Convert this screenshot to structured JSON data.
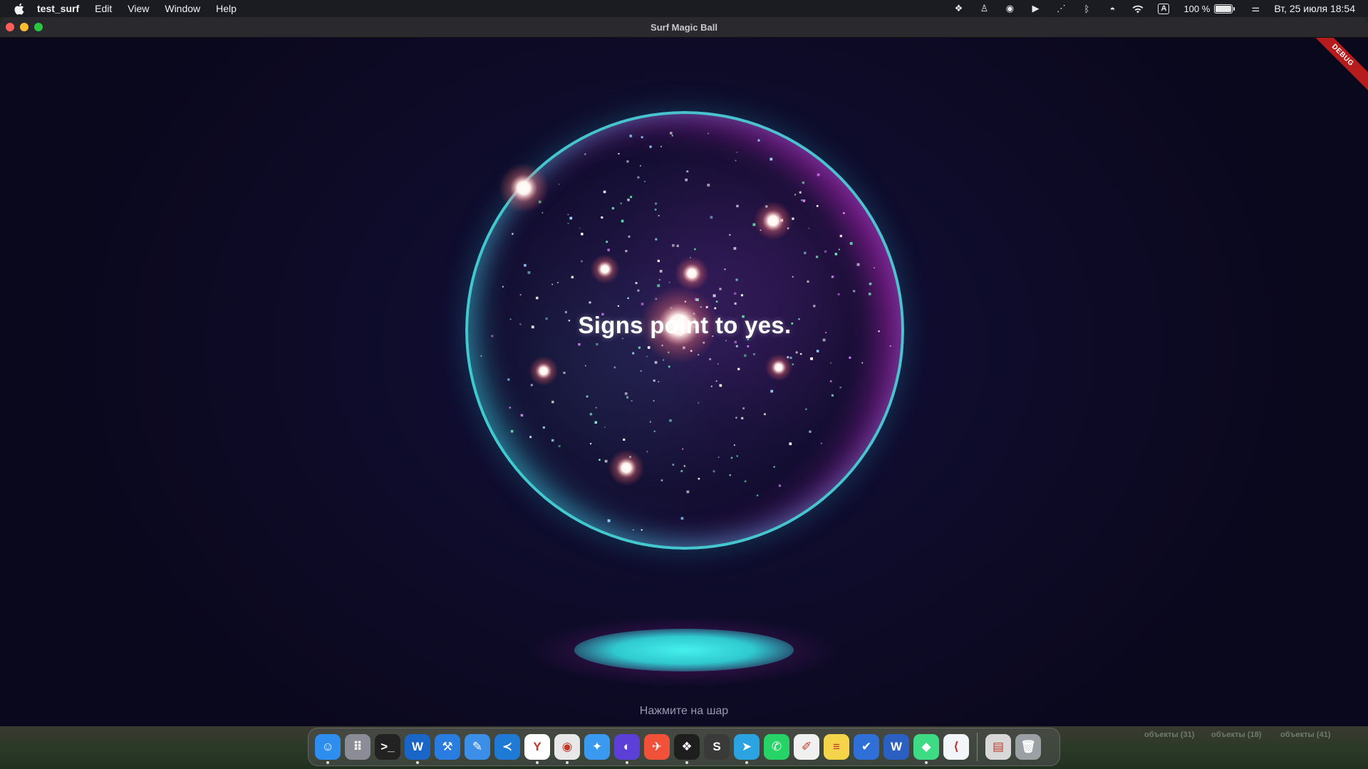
{
  "menubar": {
    "app_name": "test_surf",
    "items": [
      "Edit",
      "View",
      "Window",
      "Help"
    ],
    "status_icons": [
      "figma-icon",
      "android-icon",
      "compass-icon",
      "play-icon",
      "activity-icon",
      "bluetooth-icon",
      "focus-icon",
      "wifi-icon"
    ],
    "input_source": "A",
    "battery_percent": "100 %",
    "battery_level": 1.0,
    "clock": "Вт, 25 июля  18:54"
  },
  "window": {
    "title": "Surf Magic Ball",
    "debug_label": "DEBUG",
    "answer": "Signs point to yes.",
    "hint": "Нажмите на шар"
  },
  "desktop": {
    "labels": [
      "объекты (31)",
      "объекты (18)",
      "объекты (41)"
    ]
  },
  "dock": {
    "apps": [
      {
        "name": "finder-icon",
        "color": "#2e8ef0",
        "glyph": "☺",
        "running": true
      },
      {
        "name": "launchpad-icon",
        "color": "#8c8c96",
        "glyph": "⠿",
        "running": false
      },
      {
        "name": "terminal-icon",
        "color": "#222222",
        "glyph": ">_",
        "running": false
      },
      {
        "name": "wireshark-icon",
        "color": "#1a66c8",
        "glyph": "W",
        "running": true
      },
      {
        "name": "xcode-icon",
        "color": "#2a7de0",
        "glyph": "⚒",
        "running": false
      },
      {
        "name": "xcode-tools-icon",
        "color": "#3b8fe8",
        "glyph": "✎",
        "running": false
      },
      {
        "name": "vscode-icon",
        "color": "#1f7ad6",
        "glyph": "≺",
        "running": false
      },
      {
        "name": "yandex-icon",
        "color": "#ffffff",
        "glyph": "Y",
        "running": true
      },
      {
        "name": "chrome-icon",
        "color": "#e8e8e8",
        "glyph": "◉",
        "running": true
      },
      {
        "name": "safari-icon",
        "color": "#3a9af0",
        "glyph": "✦",
        "running": false
      },
      {
        "name": "proton-icon",
        "color": "#5b3fd6",
        "glyph": "◐",
        "running": true
      },
      {
        "name": "swift-icon",
        "color": "#f05138",
        "glyph": "✈",
        "running": false
      },
      {
        "name": "figma-icon",
        "color": "#1e1e1e",
        "glyph": "❖",
        "running": true
      },
      {
        "name": "sublime-icon",
        "color": "#3a3a3a",
        "glyph": "S",
        "running": false
      },
      {
        "name": "telegram-icon",
        "color": "#2aa3e0",
        "glyph": "➤",
        "running": true
      },
      {
        "name": "whatsapp-icon",
        "color": "#25d366",
        "glyph": "✆",
        "running": false
      },
      {
        "name": "textedit-icon",
        "color": "#f0f0f0",
        "glyph": "✐",
        "running": false
      },
      {
        "name": "notes-icon",
        "color": "#f6d44a",
        "glyph": "≡",
        "running": false
      },
      {
        "name": "tasks-icon",
        "color": "#2f6fd8",
        "glyph": "✔",
        "running": false
      },
      {
        "name": "word-icon",
        "color": "#2b5fc2",
        "glyph": "W",
        "running": false
      },
      {
        "name": "android-studio-icon",
        "color": "#3ddc84",
        "glyph": "◆",
        "running": true
      },
      {
        "name": "flutter-icon",
        "color": "#f2f6fb",
        "glyph": "⟨",
        "running": false
      }
    ],
    "extras": [
      {
        "name": "documents-stack-icon",
        "color": "#d8d8d8",
        "glyph": "▤"
      },
      {
        "name": "trash-icon",
        "color": "#9aa0a4",
        "glyph": "🗑"
      }
    ]
  },
  "colors": {
    "orb_rim": "#46dcdc",
    "orb_magenta": "#c828c8",
    "shadow": "#45f0ec",
    "background": "#0e0c24"
  }
}
